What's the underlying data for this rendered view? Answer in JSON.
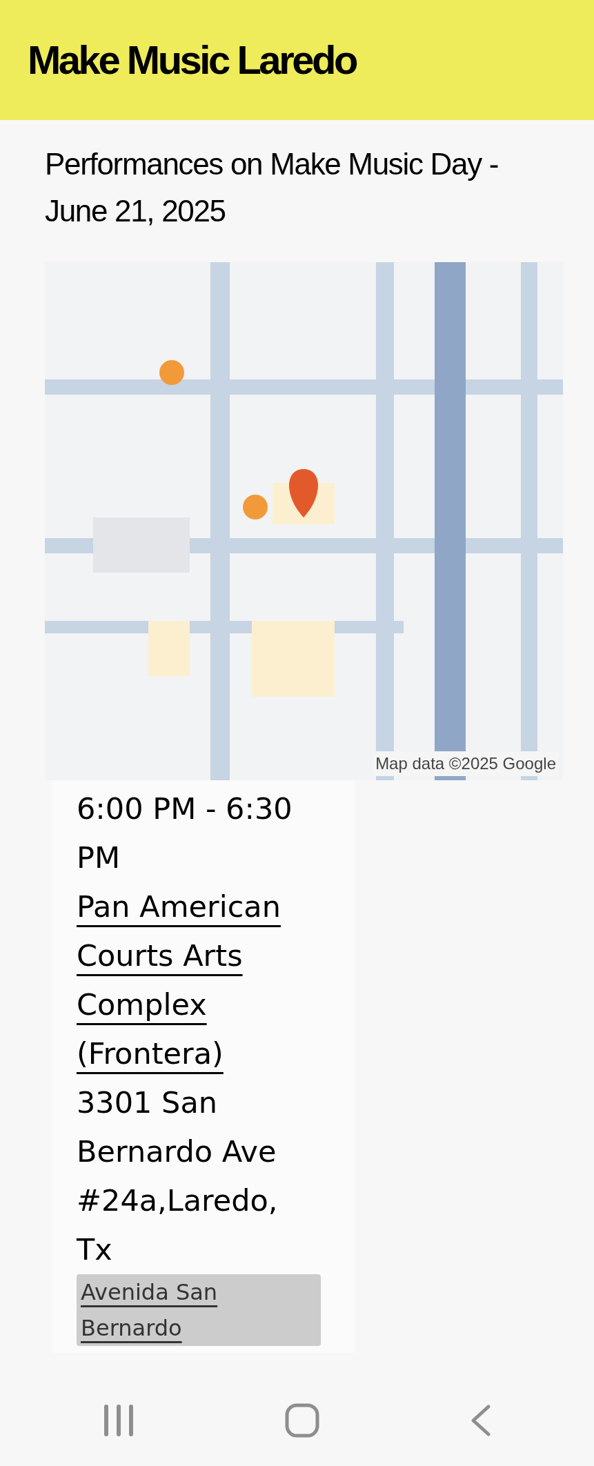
{
  "header": {
    "title": "Make Music Laredo"
  },
  "heading": "Performances on Make Music Day - June 21, 2025",
  "map": {
    "attribution": "Map data ©2025 Google"
  },
  "event": {
    "time": "6:00 PM - 6:30 PM",
    "venue": "Pan American Courts Arts Complex (Frontera)",
    "address": "3301 San Bernardo Ave #24a,Laredo, Tx",
    "tag": "Avenida San Bernardo"
  }
}
